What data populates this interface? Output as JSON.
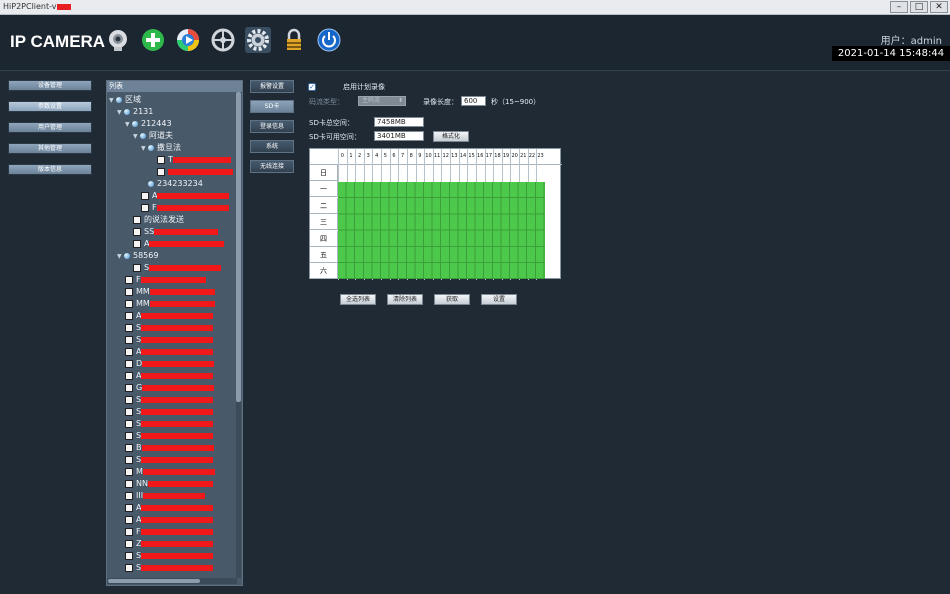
{
  "window": {
    "title": "HiP2PClient-v"
  },
  "header": {
    "logo": "IP CAMERA",
    "user": "用户：admin",
    "datetime": "2021-01-14 15:48:44",
    "icons": [
      "camera-icon",
      "add-icon",
      "playback-icon",
      "ptz-icon",
      "settings-icon",
      "lock-icon",
      "power-icon"
    ]
  },
  "left_nav": {
    "items": [
      {
        "label": "设备管理",
        "active": false
      },
      {
        "label": "参数设置",
        "active": true
      },
      {
        "label": "用户管理",
        "active": false
      },
      {
        "label": "其他管理",
        "active": false
      },
      {
        "label": "版本信息",
        "active": false
      }
    ]
  },
  "tree": {
    "header": "列表",
    "nodes": [
      {
        "label": "区域"
      },
      {
        "label": "2131"
      },
      {
        "label": "212443"
      },
      {
        "label": "阿道夫"
      },
      {
        "label": "撒旦法"
      },
      {
        "label": "T"
      },
      {
        "label": ""
      },
      {
        "label": "234233234"
      },
      {
        "label": "A"
      },
      {
        "label": "F"
      },
      {
        "label": "的说法发送"
      },
      {
        "label": "SS"
      },
      {
        "label": "A"
      },
      {
        "label": "58569"
      },
      {
        "label": "S"
      },
      {
        "label": "F"
      },
      {
        "label": "MM"
      },
      {
        "label": "MM"
      },
      {
        "label": "A"
      },
      {
        "label": "S"
      },
      {
        "label": "S"
      },
      {
        "label": "A"
      },
      {
        "label": "D"
      },
      {
        "label": "A"
      },
      {
        "label": "G"
      },
      {
        "label": "S"
      },
      {
        "label": "S"
      },
      {
        "label": "S"
      },
      {
        "label": "S"
      },
      {
        "label": "B"
      },
      {
        "label": "S"
      },
      {
        "label": "M"
      },
      {
        "label": "NN"
      },
      {
        "label": "III"
      },
      {
        "label": "A"
      },
      {
        "label": "A"
      },
      {
        "label": "F"
      },
      {
        "label": "Z"
      },
      {
        "label": "S"
      },
      {
        "label": "S"
      }
    ]
  },
  "sub_nav": {
    "items": [
      {
        "label": "报警设置",
        "active": false
      },
      {
        "label": "SD卡",
        "active": true
      },
      {
        "label": "登录信息",
        "active": false
      },
      {
        "label": "系统",
        "active": false
      },
      {
        "label": "无线连接",
        "active": false
      }
    ]
  },
  "sd_panel": {
    "enable_label": "启用计划录像",
    "enable_checked": true,
    "stream_type_label": "码流类型：",
    "stream_type_value": "主码流",
    "record_length_label": "录像长度：",
    "record_length_value": "600",
    "record_length_unit": "秒（15~900）",
    "total_label": "SD卡总空间：",
    "total_value": "7458MB",
    "free_label": "SD卡可用空间：",
    "free_value": "3401MB",
    "format_button": "格式化",
    "buttons": {
      "select_all": "全选列表",
      "clear": "清除列表",
      "get": "获取",
      "set": "设置"
    }
  },
  "schedule": {
    "hours": [
      "0",
      "1",
      "2",
      "3",
      "4",
      "5",
      "6",
      "7",
      "8",
      "9",
      "10",
      "11",
      "12",
      "13",
      "14",
      "15",
      "16",
      "17",
      "18",
      "19",
      "20",
      "21",
      "22",
      "23"
    ],
    "days": [
      "日",
      "一",
      "二",
      "三",
      "四",
      "五",
      "六"
    ],
    "enabled": [
      [],
      [
        0,
        1,
        2,
        3,
        4,
        5,
        6,
        7,
        8,
        9,
        10,
        11,
        12,
        13,
        14,
        15,
        16,
        17,
        18,
        19,
        20,
        21,
        22,
        23
      ],
      [
        0,
        1,
        2,
        3,
        4,
        5,
        6,
        7,
        8,
        9,
        10,
        11,
        12,
        13,
        14,
        15,
        16,
        17,
        18,
        19,
        20,
        21,
        22,
        23
      ],
      [
        0,
        1,
        2,
        3,
        4,
        5,
        6,
        7,
        8,
        9,
        10,
        11,
        12,
        13,
        14,
        15,
        16,
        17,
        18,
        19,
        20,
        21,
        22,
        23
      ],
      [
        0,
        1,
        2,
        3,
        4,
        5,
        6,
        7,
        8,
        9,
        10,
        11,
        12,
        13,
        14,
        15,
        16,
        17,
        18,
        19,
        20,
        21,
        22,
        23
      ],
      [
        0,
        1,
        2,
        3,
        4,
        5,
        6,
        7,
        8,
        9,
        10,
        11,
        12,
        13,
        14,
        15,
        16,
        17,
        18,
        19,
        20,
        21,
        22,
        23
      ],
      [
        0,
        1,
        2,
        3,
        4,
        5,
        6,
        7,
        8,
        9,
        10,
        11,
        12,
        13,
        14,
        15,
        16,
        17,
        18,
        19,
        20,
        21,
        22,
        23
      ]
    ]
  },
  "colors": {
    "schedule_on": "#4cc84a",
    "redaction": "#f01818",
    "background": "#1f2a35"
  }
}
